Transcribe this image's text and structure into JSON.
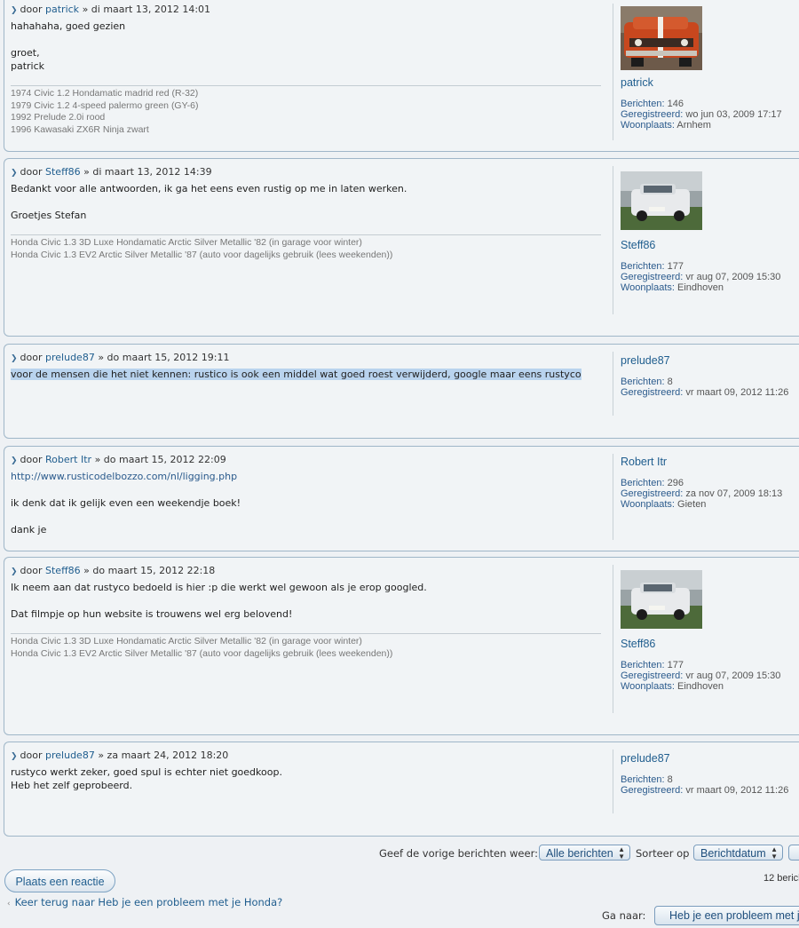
{
  "posts": [
    {
      "by": "door",
      "author": "patrick",
      "date": "» di maart 13, 2012 14:01",
      "lines": [
        "hahahaha, goed gezien",
        "",
        "groet,",
        "patrick"
      ],
      "signature": [
        "1974 Civic 1.2 Hondamatic madrid red (R-32)",
        "1979 Civic 1.2 4-speed palermo green (GY-6)",
        "1992 Prelude 2.0i rood",
        "1996 Kawasaki ZX6R Ninja zwart"
      ],
      "profile": {
        "name": "patrick",
        "avatar": "red-civic",
        "posts_label": "Berichten:",
        "posts": "146",
        "registered_label": "Geregistreerd:",
        "registered": "wo jun 03, 2009 17:17",
        "location_label": "Woonplaats:",
        "location": "Arnhem"
      }
    },
    {
      "by": "door",
      "author": "Steff86",
      "date": "» di maart 13, 2012 14:39",
      "lines": [
        "Bedankt voor alle antwoorden, ik ga het eens even rustig op me in laten werken.",
        "",
        "Groetjes Stefan"
      ],
      "signature": [
        "Honda Civic 1.3 3D Luxe Hondamatic Arctic Silver Metallic '82 (in garage voor winter)",
        "Honda Civic 1.3 EV2 Arctic Silver Metallic '87 (auto voor dagelijks gebruik (lees weekenden))"
      ],
      "profile": {
        "name": "Steff86",
        "avatar": "silver-civic",
        "posts_label": "Berichten:",
        "posts": "177",
        "registered_label": "Geregistreerd:",
        "registered": "vr aug 07, 2009 15:30",
        "location_label": "Woonplaats:",
        "location": "Eindhoven"
      }
    },
    {
      "by": "door",
      "author": "prelude87",
      "date": "» do maart 15, 2012 19:11",
      "lines": [
        "voor de mensen die het niet kennen: rustico is ook een middel wat goed roest verwijderd, google maar eens rustyco"
      ],
      "signature": [],
      "profile": {
        "name": "prelude87",
        "avatar": "",
        "posts_label": "Berichten:",
        "posts": "8",
        "registered_label": "Geregistreerd:",
        "registered": "vr maart 09, 2012 11:26",
        "location_label": "",
        "location": ""
      }
    },
    {
      "by": "door",
      "author": "Robert Itr",
      "date": "» do maart 15, 2012 22:09",
      "link": "http://www.rusticodelbozzo.com/nl/ligging.php",
      "lines": [
        "",
        "ik denk dat ik gelijk even een weekendje boek!",
        "",
        "dank je"
      ],
      "signature": [],
      "profile": {
        "name": "Robert Itr",
        "avatar": "",
        "posts_label": "Berichten:",
        "posts": "296",
        "registered_label": "Geregistreerd:",
        "registered": "za nov 07, 2009 18:13",
        "location_label": "Woonplaats:",
        "location": "Gieten"
      }
    },
    {
      "by": "door",
      "author": "Steff86",
      "date": "» do maart 15, 2012 22:18",
      "lines": [
        "Ik neem aan dat rustyco bedoeld is hier :p die werkt wel gewoon als je erop googled.",
        "",
        "Dat filmpje op hun website is trouwens wel erg belovend!"
      ],
      "signature": [
        "Honda Civic 1.3 3D Luxe Hondamatic Arctic Silver Metallic '82 (in garage voor winter)",
        "Honda Civic 1.3 EV2 Arctic Silver Metallic '87 (auto voor dagelijks gebruik (lees weekenden))"
      ],
      "profile": {
        "name": "Steff86",
        "avatar": "silver-civic",
        "posts_label": "Berichten:",
        "posts": "177",
        "registered_label": "Geregistreerd:",
        "registered": "vr aug 07, 2009 15:30",
        "location_label": "Woonplaats:",
        "location": "Eindhoven"
      }
    },
    {
      "by": "door",
      "author": "prelude87",
      "date": "» za maart 24, 2012 18:20",
      "lines": [
        "rustyco werkt zeker, goed spul is echter niet goedkoop.",
        "Heb het zelf geprobeerd."
      ],
      "signature": [],
      "profile": {
        "name": "prelude87",
        "avatar": "",
        "posts_label": "Berichten:",
        "posts": "8",
        "registered_label": "Geregistreerd:",
        "registered": "vr maart 09, 2012 11:26",
        "location_label": "",
        "location": ""
      }
    }
  ],
  "bottom": {
    "display_label": "Geef de vorige berichten weer:",
    "display_value": "Alle berichten",
    "sort_label": "Sorteer op",
    "sort_value": "Berichtdatum",
    "reply_button": "Plaats een reactie",
    "count": "12 berich",
    "back_link": "Keer terug naar Heb je een probleem met je Honda?",
    "jump_label": "Ga naar:",
    "jump_value": "Heb je een probleem met je Honda?"
  }
}
